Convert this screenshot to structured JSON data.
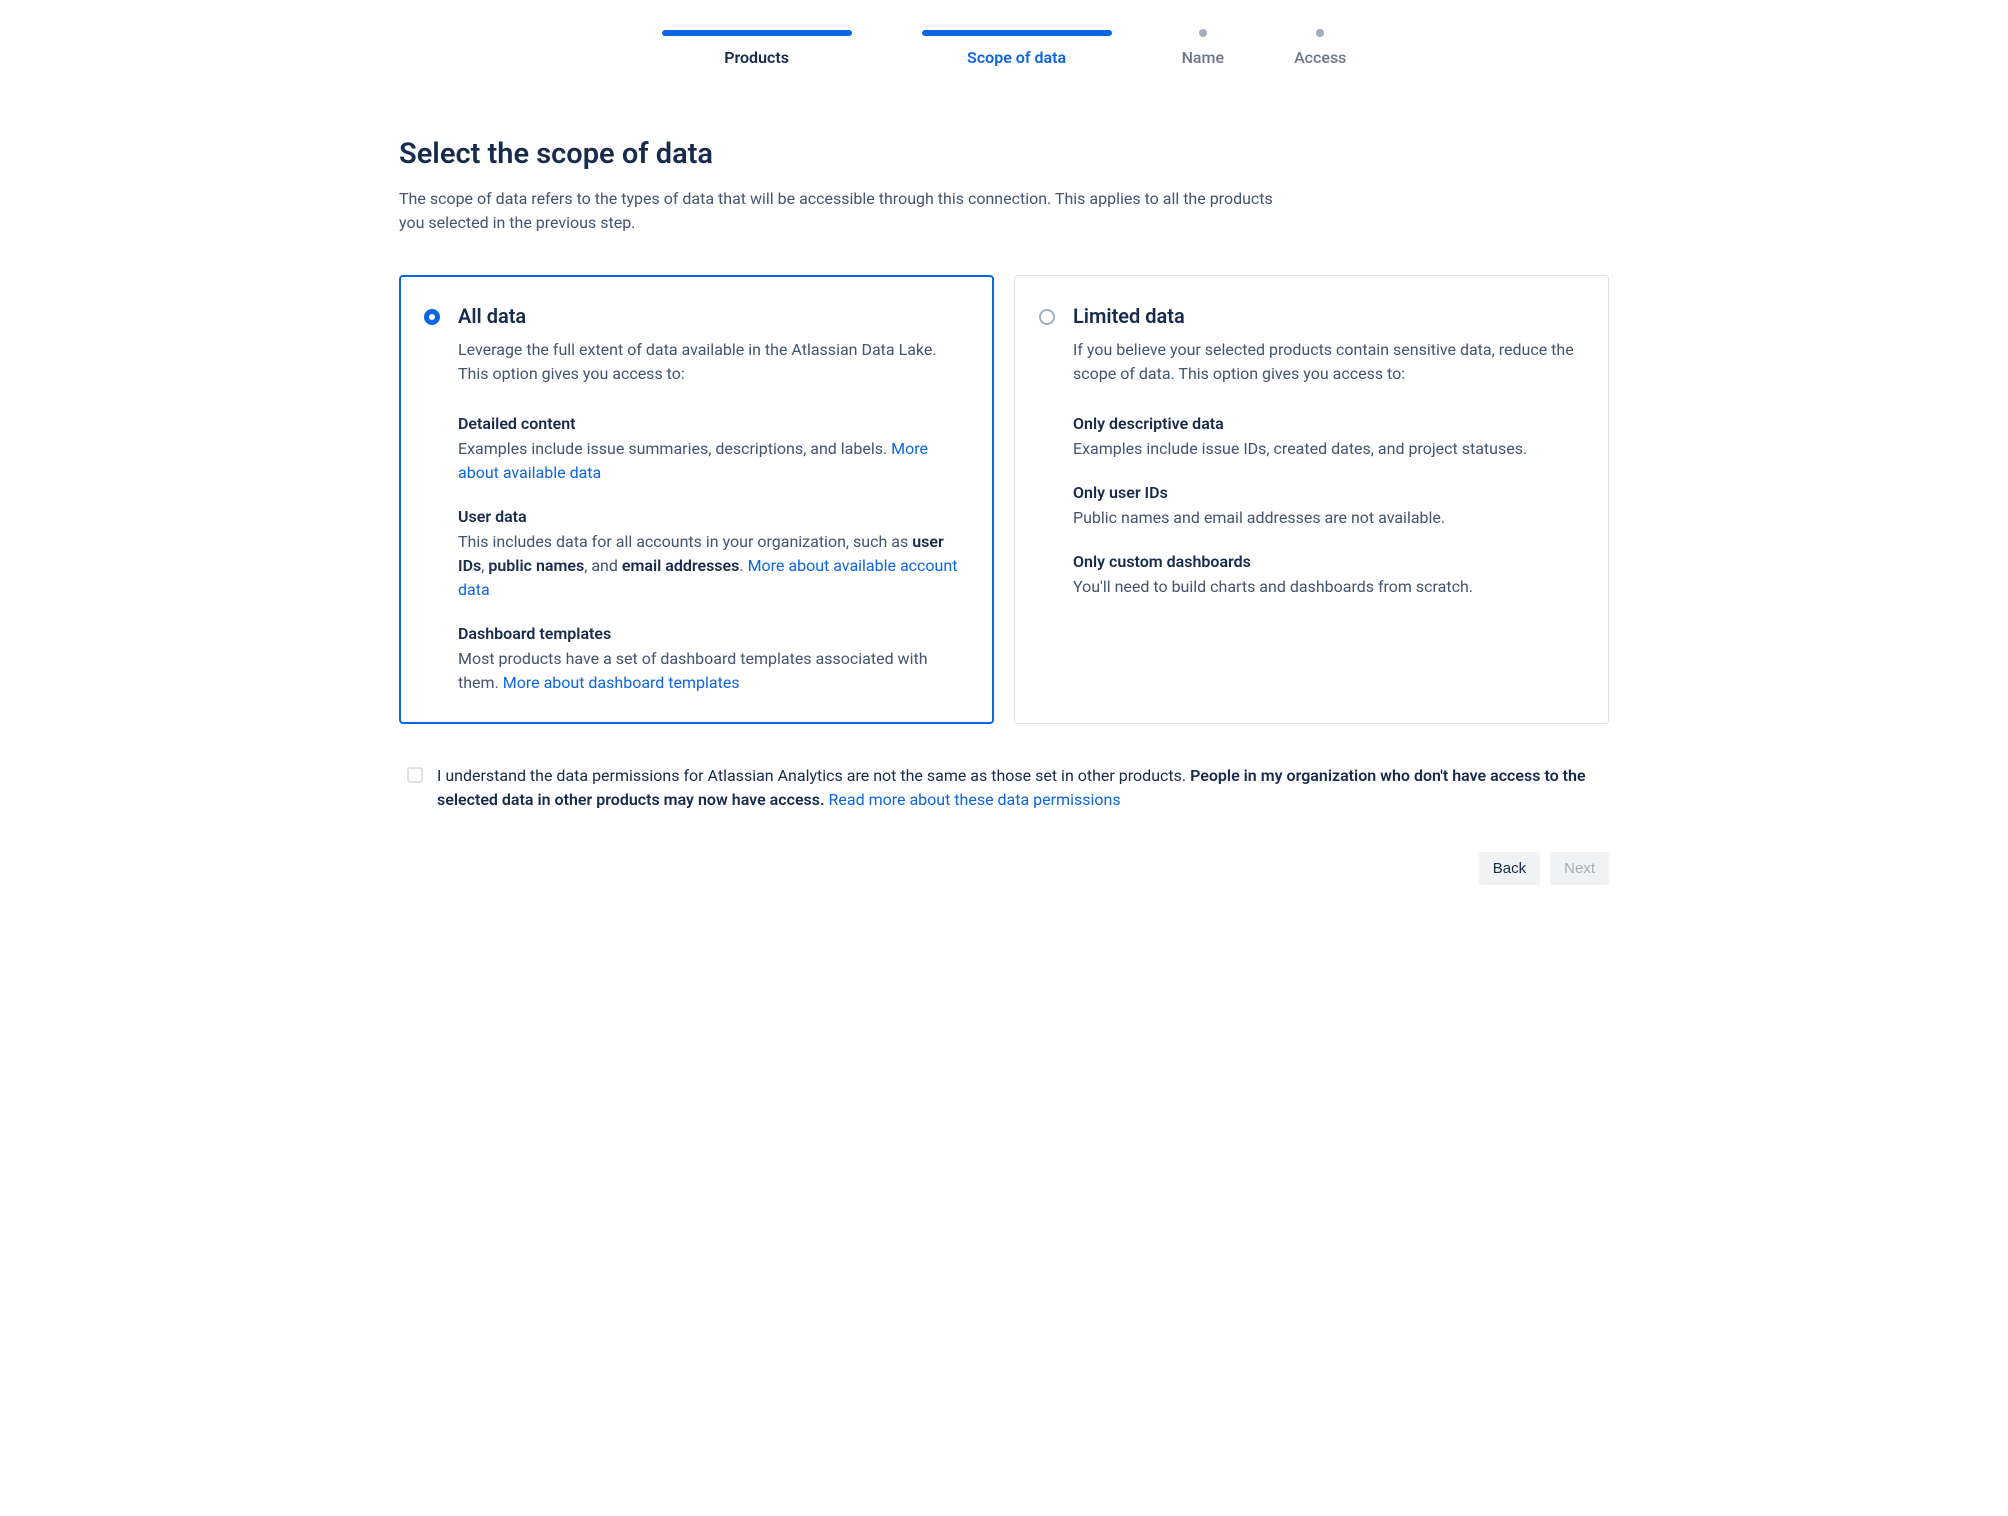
{
  "stepper": {
    "products": "Products",
    "scope": "Scope of data",
    "name": "Name",
    "access": "Access"
  },
  "page": {
    "title": "Select the scope of data",
    "subtitle": "The scope of data refers to the types of data that will be accessible through this connection. This applies to all the products you selected in the previous step."
  },
  "optionA": {
    "title": "All data",
    "desc": "Leverage the full extent of data available in the Atlassian Data Lake. This option gives you access to:",
    "s1_title": "Detailed content",
    "s1_text": "Examples include issue summaries, descriptions, and labels. ",
    "s1_link": "More about available data",
    "s2_title": "User data",
    "s2_pre": "This includes data for all accounts in your organization, such as ",
    "s2_b1": "user IDs",
    "s2_sep1": ", ",
    "s2_b2": "public names",
    "s2_sep2": ", and ",
    "s2_b3": "email addresses",
    "s2_post": ". ",
    "s2_link": "More about available account data",
    "s3_title": "Dashboard templates",
    "s3_text": "Most products have a set of dashboard templates associated with them. ",
    "s3_link": "More about dashboard templates"
  },
  "optionB": {
    "title": "Limited data",
    "desc": "If you believe your selected products contain sensitive data, reduce the scope of data. This option gives you access to:",
    "s1_title": "Only descriptive data",
    "s1_text": "Examples include issue IDs, created dates, and project statuses.",
    "s2_title": "Only user IDs",
    "s2_text": "Public names and email addresses are not available.",
    "s3_title": "Only custom dashboards",
    "s3_text": "You'll need to build charts and dashboards from scratch."
  },
  "ack": {
    "pre": "I understand the data permissions for Atlassian Analytics are not the same as those set in other products. ",
    "bold": "People in my organization who don't have access to the selected data in other products may now have access.",
    "post": " ",
    "link": "Read more about these data permissions"
  },
  "footer": {
    "back": "Back",
    "next": "Next"
  }
}
